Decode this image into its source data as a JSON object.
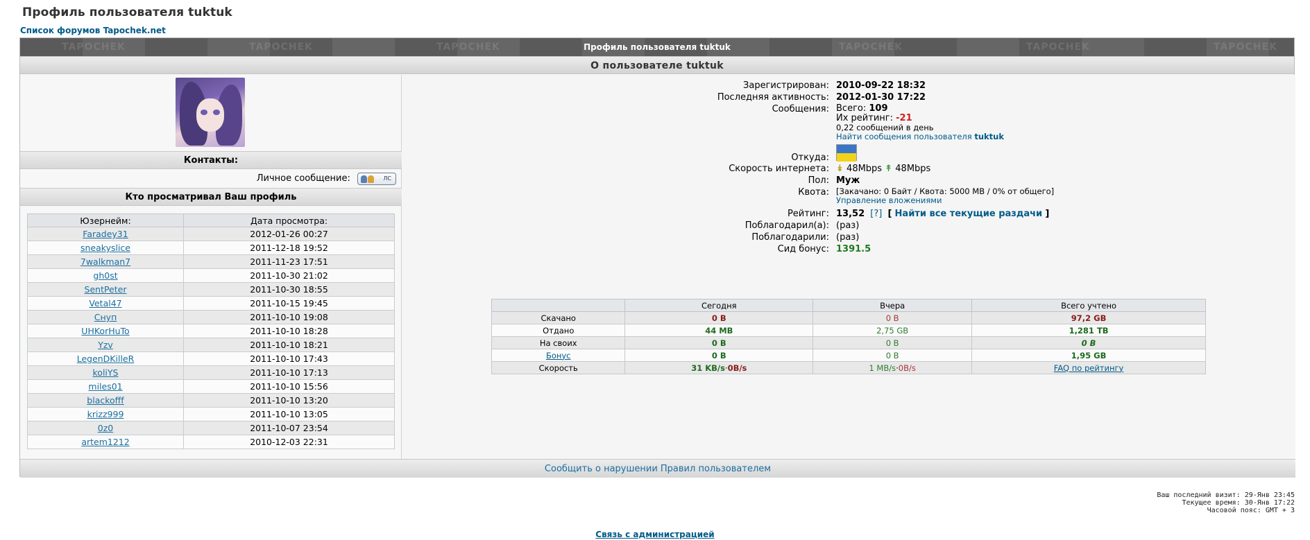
{
  "page": {
    "title": "Профиль пользователя tuktuk",
    "forum_link": "Список форумов Tapochek.net"
  },
  "frame": {
    "header": "Профиль пользователя tuktuk",
    "about_header": "О пользователе tuktuk",
    "watermark": "TAPOCHEK"
  },
  "left": {
    "contacts_header": "Контакты:",
    "pm_label": "Личное сообщение:",
    "pm_button": "ЛС",
    "viewers_header": "Кто просматривал Ваш профиль",
    "columns": [
      "Юзернейм:",
      "Дата просмотра:"
    ],
    "viewers": [
      {
        "user": "Faradey31",
        "date": "2012-01-26 00:27"
      },
      {
        "user": "sneakyslice",
        "date": "2011-12-18 19:52"
      },
      {
        "user": "7walkman7",
        "date": "2011-11-23 17:51"
      },
      {
        "user": "gh0st",
        "date": "2011-10-30 21:02"
      },
      {
        "user": "SentPeter",
        "date": "2011-10-30 18:55"
      },
      {
        "user": "Vetal47",
        "date": "2011-10-15 19:45"
      },
      {
        "user": "Снуп",
        "date": "2011-10-10 19:08"
      },
      {
        "user": "UHKorHuTo",
        "date": "2011-10-10 18:28"
      },
      {
        "user": "Yzv",
        "date": "2011-10-10 18:21"
      },
      {
        "user": "LegenDKilleR",
        "date": "2011-10-10 17:43"
      },
      {
        "user": "koliYS",
        "date": "2011-10-10 17:13"
      },
      {
        "user": "miles01",
        "date": "2011-10-10 15:56"
      },
      {
        "user": "blackofff",
        "date": "2011-10-10 13:20"
      },
      {
        "user": "krizz999",
        "date": "2011-10-10 13:05"
      },
      {
        "user": "0z0",
        "date": "2011-10-07 23:54"
      },
      {
        "user": "artem1212",
        "date": "2010-12-03 22:31"
      }
    ]
  },
  "info": {
    "registered_label": "Зарегистрирован:",
    "registered": "2010-09-22 18:32",
    "last_active_label": "Последняя активность:",
    "last_active": "2012-01-30 17:22",
    "messages_label": "Сообщения:",
    "messages_total_label": "Всего:",
    "messages_total": "109",
    "rating_label": "Их рейтинг:",
    "rating": "-21",
    "per_day": "0,22 сообщений в день",
    "find_posts": "Найти сообщения пользователя",
    "username": "tuktuk",
    "from_label": "Откуда:",
    "speed_label": "Скорость интернета:",
    "speed_down": "48Mbps",
    "speed_up": "48Mbps",
    "gender_label": "Пол:",
    "gender": "Муж",
    "quota_label": "Квота:",
    "quota": "[Закачано: 0 Байт / Квота: 5000 MB / 0% от общего]",
    "attachments_link": "Управление вложениями",
    "user_rating_label": "Рейтинг:",
    "user_rating": "13,52",
    "help": "[?]",
    "find_torrents": "Найти все текущие раздачи",
    "thanked_label": "Поблагодарил(а):",
    "thanked": "(раз)",
    "thanked_by_label": "Поблагодарили:",
    "thanked_by": "(раз)",
    "seed_bonus_label": "Сид бонус:",
    "seed_bonus": "1391.5"
  },
  "stats": {
    "columns": [
      "",
      "Сегодня",
      "Вчера",
      "Всего учтено"
    ],
    "rows": [
      {
        "label": "Скачано",
        "today": "0 B",
        "yesterday": "0 B",
        "total": "97,2 GB"
      },
      {
        "label": "Отдано",
        "today": "44 MB",
        "yesterday": "2,75 GB",
        "total": "1,281 TB"
      },
      {
        "label": "На своих",
        "today": "0 B",
        "yesterday": "0 B",
        "total": "0 B"
      },
      {
        "label": "Бонус",
        "today": "0 B",
        "yesterday": "0 B",
        "total": "1,95 GB"
      }
    ],
    "speed": {
      "label": "Скорость",
      "today_down": "31 KB/s",
      "today_sep": "·",
      "today_up": "0B/s",
      "yesterday_down": "1 MB/s",
      "yesterday_sep": "·",
      "yesterday_up": "0B/s",
      "faq": "FAQ по рейтингу"
    }
  },
  "footer": {
    "report": "Сообщить о нарушении Правил пользователем",
    "last_visit": "Ваш последний визит: 29-Янв 23:45",
    "current_time": "Текущее время: 30-Янв 17:22",
    "timezone": "Часовой пояс: GMT + 3",
    "admin": "Связь с администрацией"
  },
  "colors": {
    "link": "#005b8a",
    "negative": "#cc1f1f",
    "positive": "#1d7a1d",
    "header_bar": "#5a5a5a"
  }
}
